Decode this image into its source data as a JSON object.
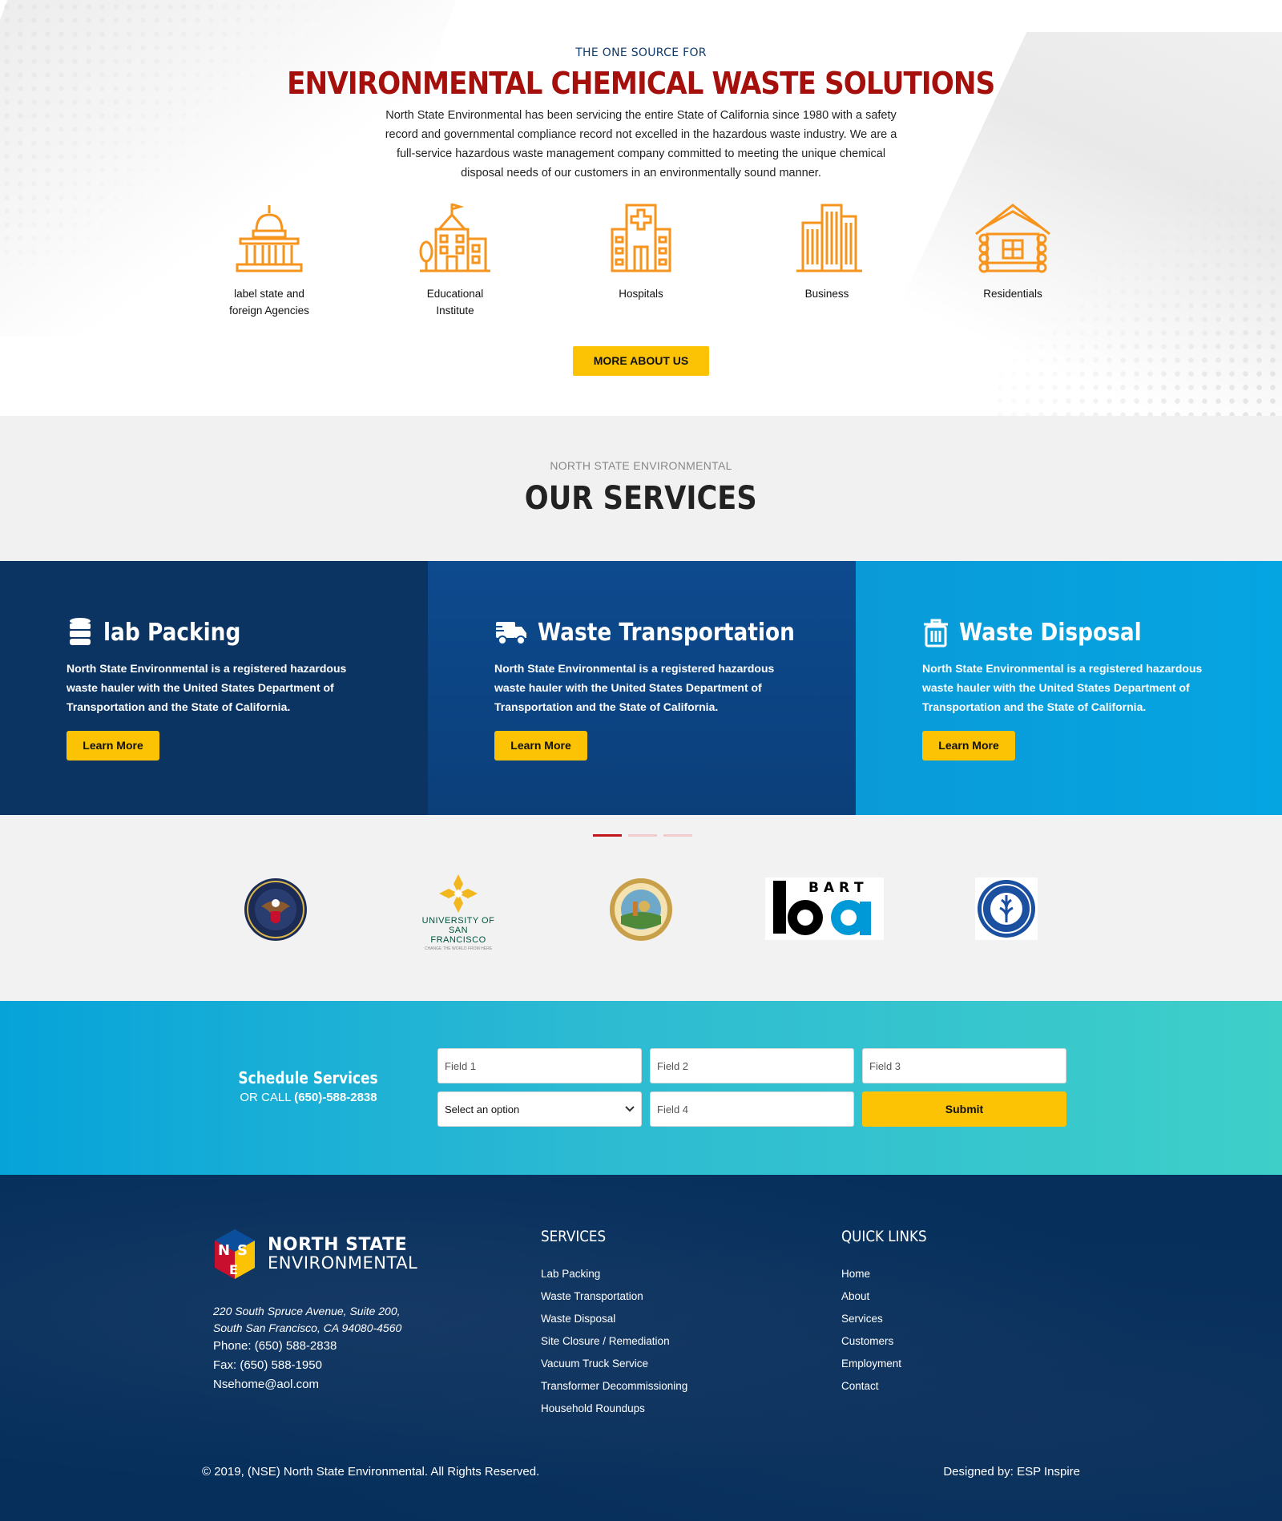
{
  "intro": {
    "eyebrow": "THE ONE SOURCE FOR",
    "title": "ENVIRONMENTAL CHEMICAL WASTE SOLUTIONS",
    "description": "North State Environmental has been servicing the entire State of California since 1980 with a safety record and governmental compliance record not excelled in the hazardous waste industry. We are a full-service hazardous waste management company committed to meeting the unique chemical disposal needs of our customers in an environmentally sound manner.",
    "industries": [
      {
        "icon": "capitol-building-icon",
        "label": "label state and foreign Agencies"
      },
      {
        "icon": "school-building-icon",
        "label": "Educational Institute"
      },
      {
        "icon": "hospital-icon",
        "label": "Hospitals"
      },
      {
        "icon": "office-buildings-icon",
        "label": "Business"
      },
      {
        "icon": "log-cabin-icon",
        "label": "Residentials"
      }
    ],
    "more_button": "MORE ABOUT US",
    "icon_color": "#f7941d"
  },
  "services_heading": {
    "eyebrow": "NORTH STATE ENVIRONMENTAL",
    "title": "OUR SERVICES"
  },
  "service_cards": [
    {
      "icon": "barrel-icon",
      "title": "lab Packing",
      "text": "North State Environmental is a registered hazardous waste hauler with the United States Department of Transportation and the State of California.",
      "button": "Learn More"
    },
    {
      "icon": "truck-icon",
      "title": "Waste Transportation",
      "text": "North State Environmental is a registered hazardous waste hauler with the United States Department of Transportation and the State of California.",
      "button": "Learn More"
    },
    {
      "icon": "trash-can-icon",
      "title": "Waste Disposal",
      "text": "North State Environmental is a registered hazardous waste hauler with the United States Department of Transportation and the State of California.",
      "button": "Learn More"
    }
  ],
  "client_logos": {
    "pager_active": 1,
    "pager_count": 3,
    "logos": [
      {
        "name": "veterans-affairs-seal"
      },
      {
        "name": "university-of-san-francisco-logo",
        "line1": "UNIVERSITY OF",
        "line2": "SAN FRANCISCO",
        "tagline": "CHANGE THE WORLD FROM HERE"
      },
      {
        "name": "great-seal-of-california"
      },
      {
        "name": "bart-logo",
        "text": "B A R T"
      },
      {
        "name": "la-community-college-seal"
      }
    ]
  },
  "schedule": {
    "title": "Schedule Services",
    "call_prefix": "OR CALL",
    "phone": "(650)-588-2838",
    "field1_placeholder": "Field 1",
    "field2_placeholder": "Field 2",
    "field3_placeholder": "Field 3",
    "select_value": "Select an option",
    "field4_placeholder": "Field 4",
    "submit": "Submit"
  },
  "footer": {
    "brand_line1": "NORTH STATE",
    "brand_line2": "ENVIRONMENTAL",
    "address1": "220 South Spruce Avenue, Suite 200,",
    "address2": "South San Francisco, CA 94080-4560",
    "phone": "Phone: (650) 588-2838",
    "fax": "Fax: (650) 588-1950",
    "email": "Nsehome@aol.com",
    "services_title": "SERVICES",
    "services": [
      "Lab Packing",
      "Waste Transportation",
      "Waste Disposal",
      "Site Closure / Remediation",
      "Vacuum Truck Service",
      "Transformer Decommissioning",
      "Household Roundups"
    ],
    "links_title": "QUICK LINKS",
    "links": [
      "Home",
      "About",
      "Services",
      "Customers",
      "Employment",
      "Contact"
    ],
    "copyright": "© 2019, (NSE) North State Environmental. All Rights Reserved.",
    "designer": "Designed by: ESP Inspire"
  }
}
